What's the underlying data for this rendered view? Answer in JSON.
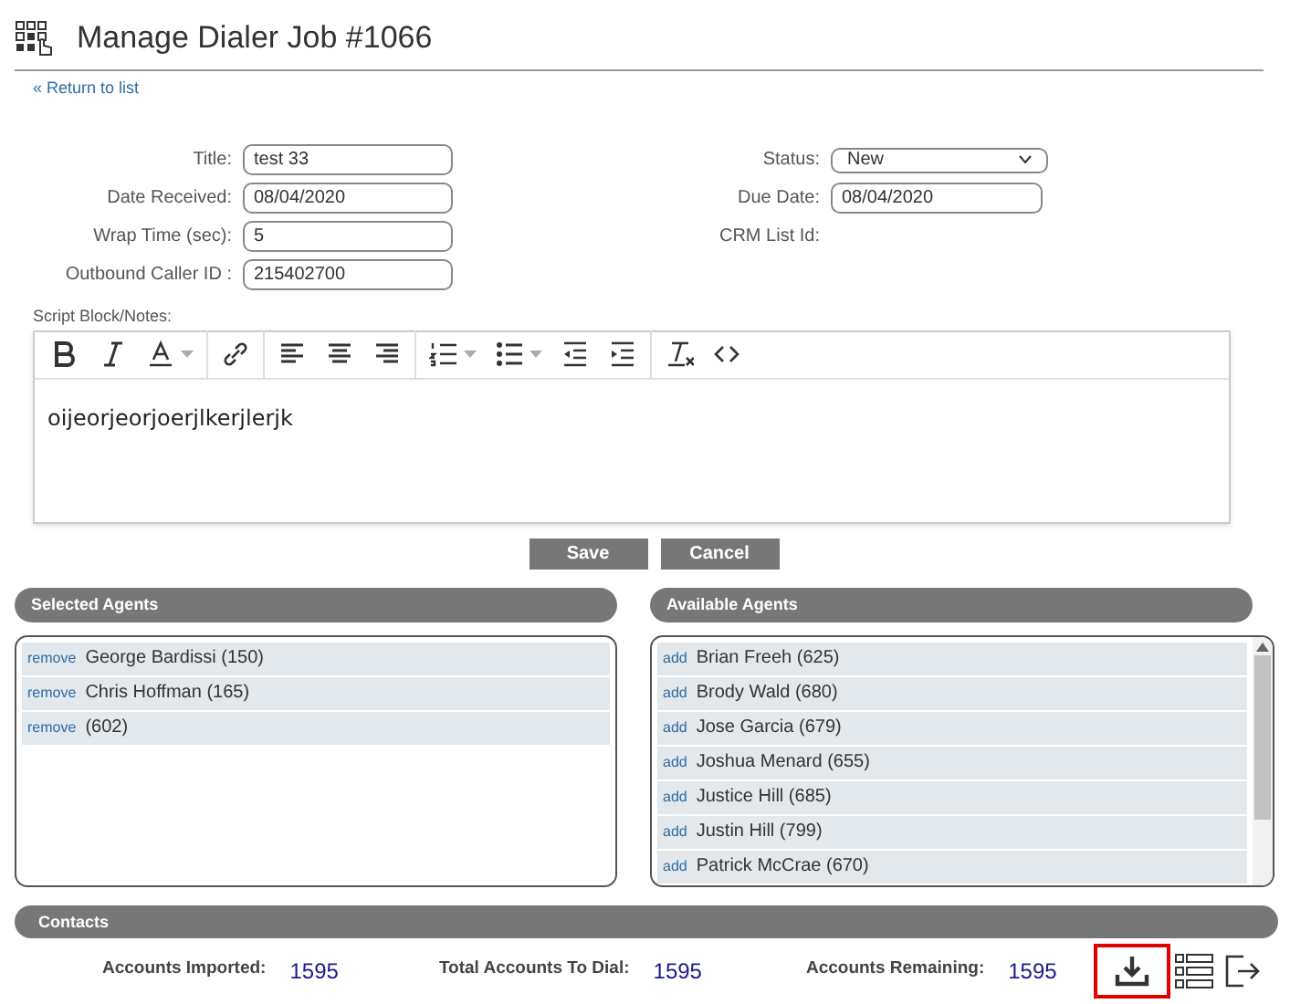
{
  "header": {
    "title": "Manage Dialer Job #1066",
    "back_link": "« Return to list"
  },
  "form_left": [
    {
      "label": "Title:",
      "value": "test 33"
    },
    {
      "label": "Date Received:",
      "value": "08/04/2020"
    },
    {
      "label": "Wrap Time (sec):",
      "value": "5"
    },
    {
      "label": "Outbound Caller ID :",
      "value": "215402700"
    }
  ],
  "form_right": [
    {
      "label": "Status:",
      "kind": "select",
      "value": "New"
    },
    {
      "label": "Due Date:",
      "kind": "input",
      "value": "08/04/2020"
    },
    {
      "label": "CRM List Id:",
      "kind": "text"
    }
  ],
  "script_block": {
    "label": "Script Block/Notes:",
    "content": "oijeorjeorjoerjlkerjlerjk"
  },
  "buttons": [
    "Save",
    "Cancel"
  ],
  "selected_agents": {
    "title": "Selected Agents",
    "items": [
      {
        "action": "remove",
        "name": "George Bardissi (150)"
      },
      {
        "action": "remove",
        "name": "Chris Hoffman (165)"
      },
      {
        "action": "remove",
        "name": "(602)"
      }
    ]
  },
  "available_agents": {
    "title": "Available Agents",
    "items": [
      {
        "action": "add",
        "name": "Brian Freeh (625)"
      },
      {
        "action": "add",
        "name": "Brody Wald (680)"
      },
      {
        "action": "add",
        "name": "Jose Garcia (679)"
      },
      {
        "action": "add",
        "name": "Joshua Menard (655)"
      },
      {
        "action": "add",
        "name": "Justice Hill (685)"
      },
      {
        "action": "add",
        "name": "Justin Hill (799)"
      },
      {
        "action": "add",
        "name": "Patrick McCrae (670)"
      }
    ]
  },
  "contacts": {
    "title": "Contacts",
    "stats": [
      {
        "label": "Accounts Imported:",
        "value": "1595"
      },
      {
        "label": "Total Accounts To Dial:",
        "value": "1595"
      },
      {
        "label": "Accounts Remaining:",
        "value": "1595"
      }
    ],
    "actions": [
      {
        "kind": "download",
        "selected": true
      },
      {
        "kind": "list",
        "selected": false
      },
      {
        "kind": "exit",
        "selected": false
      }
    ]
  }
}
